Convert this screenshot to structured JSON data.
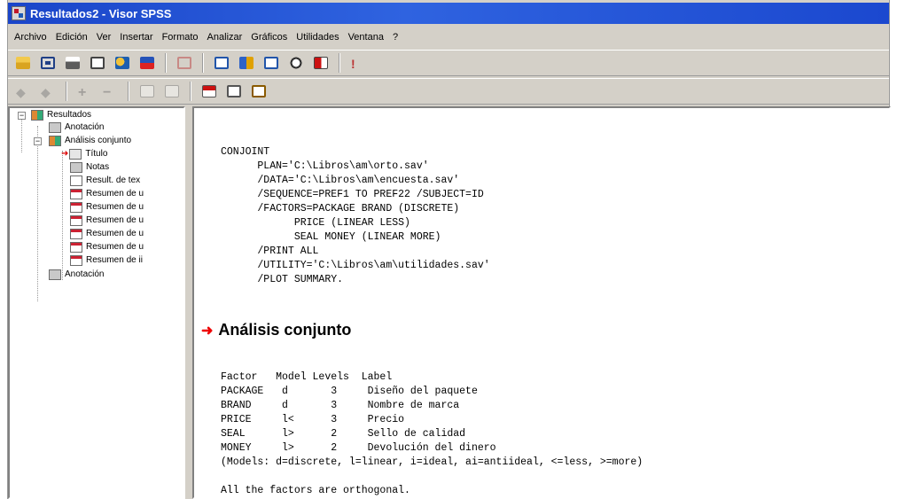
{
  "window": {
    "title": "Resultados2 - Visor SPSS"
  },
  "menubar": [
    "Archivo",
    "Edición",
    "Ver",
    "Insertar",
    "Formato",
    "Analizar",
    "Gráficos",
    "Utilidades",
    "Ventana",
    "?"
  ],
  "toolbar_icons": [
    "open-icon",
    "save-icon",
    "print-icon",
    "print-preview-icon",
    "export-icon",
    "dialog-recall-icon",
    "undo-icon",
    "goto-data-icon",
    "variables-icon",
    "info-icon",
    "find-icon",
    "insert-case-icon",
    "run-icon"
  ],
  "toolbar2_icons": [
    "promote-icon",
    "demote-icon",
    "expand-icon",
    "collapse-icon",
    "show-icon",
    "hide-icon",
    "insert-heading-icon",
    "insert-title-icon",
    "insert-text-icon"
  ],
  "tree": {
    "root": "Resultados",
    "items": [
      {
        "label": "Anotación",
        "icon": "log-icon"
      },
      {
        "label": "Análisis conjunto",
        "icon": "book-icon"
      },
      {
        "label": "Título",
        "icon": "title-icon",
        "selected": true
      },
      {
        "label": "Notas",
        "icon": "notes-icon"
      },
      {
        "label": "Result. de tex",
        "icon": "text-output-icon"
      },
      {
        "label": "Resumen de u",
        "icon": "table-icon"
      },
      {
        "label": "Resumen de u",
        "icon": "table-icon"
      },
      {
        "label": "Resumen de u",
        "icon": "table-icon"
      },
      {
        "label": "Resumen de u",
        "icon": "table-icon"
      },
      {
        "label": "Resumen de u",
        "icon": "table-icon"
      },
      {
        "label": "Resumen de ii",
        "icon": "table-icon"
      },
      {
        "label": "Anotación",
        "icon": "log-icon"
      }
    ]
  },
  "syntax": "CONJOINT\n      PLAN='C:\\Libros\\am\\orto.sav'\n      /DATA='C:\\Libros\\am\\encuesta.sav'\n      /SEQUENCE=PREF1 TO PREF22 /SUBJECT=ID\n      /FACTORS=PACKAGE BRAND (DISCRETE)\n            PRICE (LINEAR LESS)\n            SEAL MONEY (LINEAR MORE)\n      /PRINT ALL\n      /UTILITY='C:\\Libros\\am\\utilidades.sav'\n      /PLOT SUMMARY.",
  "output_title": "Análisis conjunto",
  "factor_table": "Factor   Model Levels  Label\nPACKAGE   d       3     Diseño del paquete\nBRAND     d       3     Nombre de marca\nPRICE     l<      3     Precio\nSEAL      l>      2     Sello de calidad\nMONEY     l>      2     Devolución del dinero\n(Models: d=discrete, l=linear, i=ideal, ai=antiideal, <=less, >=more)\n\nAll the factors are orthogonal."
}
